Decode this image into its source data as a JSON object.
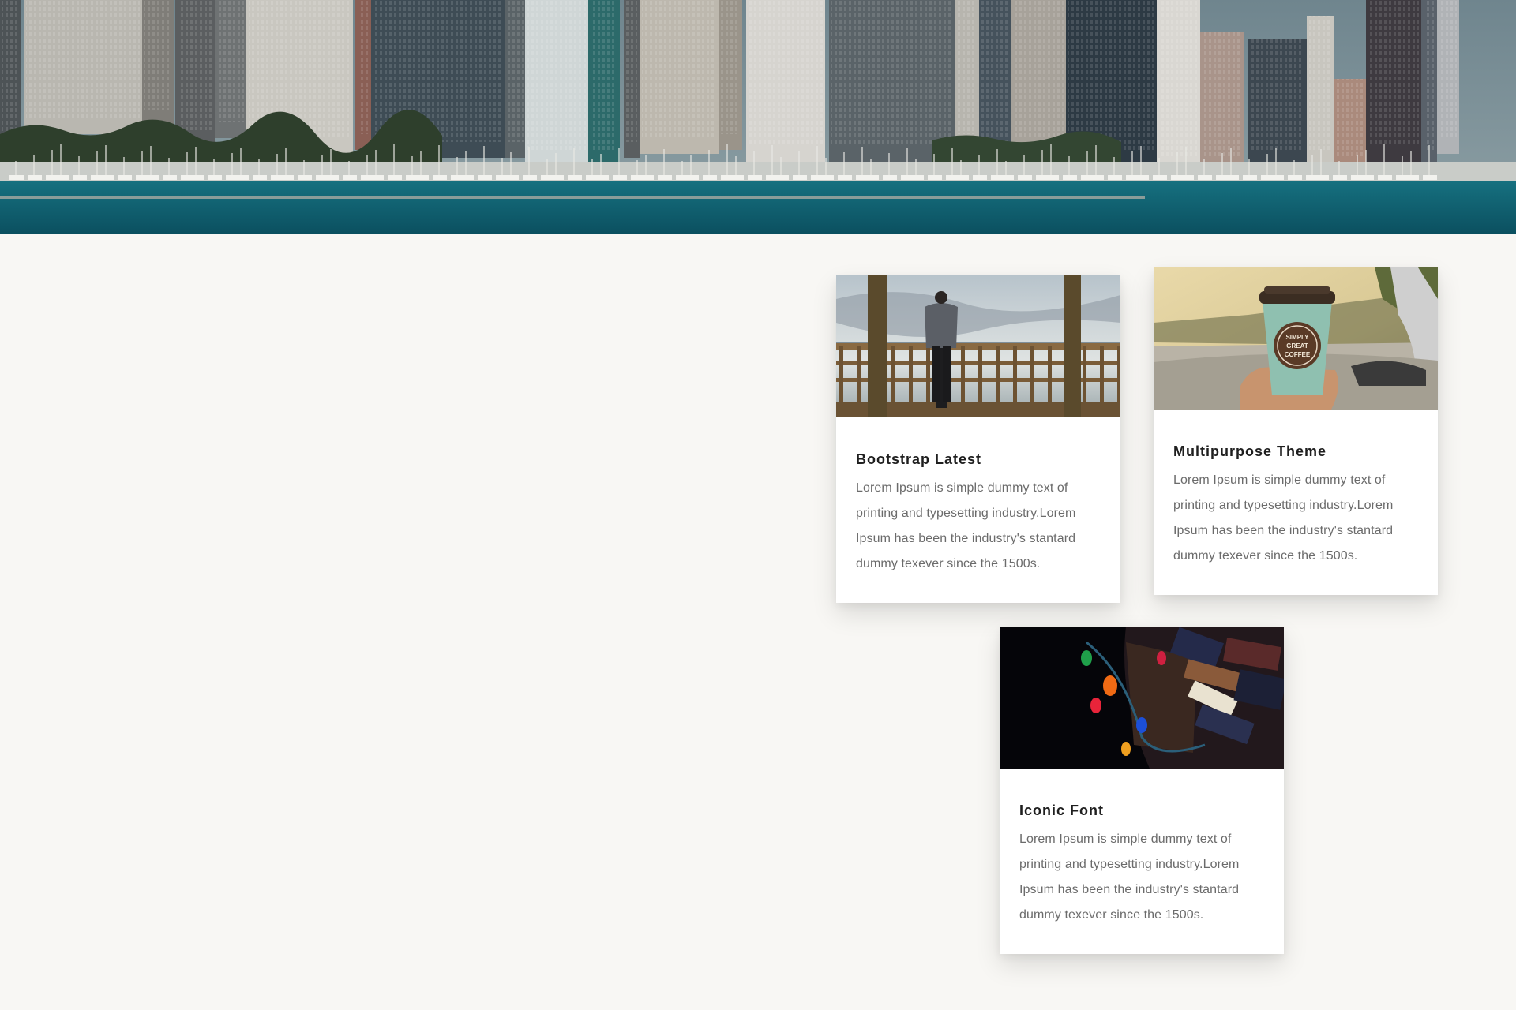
{
  "hero": {
    "image": "city-skyline-harbor"
  },
  "cards": [
    {
      "image": "man-on-pier",
      "title": "Bootstrap Latest",
      "text": "Lorem Ipsum is simple dummy text of printing and typesetting industry.Lorem Ipsum has been the industry's stantard dummy texever since the 1500s."
    },
    {
      "image": "coffee-cup-in-car",
      "image_text": [
        "SIMPLY",
        "GREAT",
        "COFFEE"
      ],
      "title": "Multipurpose Theme",
      "text": "Lorem Ipsum is simple dummy text of printing and typesetting industry.Lorem Ipsum has been the industry's stantard dummy texever since the 1500s."
    },
    {
      "image": "books-with-string-lights",
      "title": "Iconic Font",
      "text": "Lorem Ipsum is simple dummy text of printing and typesetting industry.Lorem Ipsum has been the industry's stantard dummy texever since the 1500s."
    }
  ],
  "colors": {
    "page_background": "#f8f7f4",
    "card_background": "#ffffff",
    "title": "#1f1f1f",
    "body_text": "#6b6b6b",
    "water": "#0f5e6e"
  }
}
